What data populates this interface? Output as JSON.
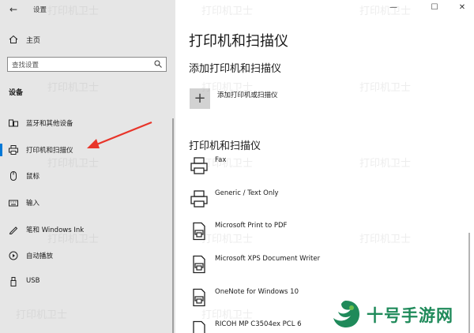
{
  "window": {
    "title": "设置",
    "minimize_icon": "minimize-icon",
    "maximize_icon": "maximize-icon",
    "close_icon": "close-icon"
  },
  "sidebar": {
    "back_icon": "back-arrow-icon",
    "home_label": "主页",
    "search_placeholder": "查找设置",
    "section_title": "设备",
    "items": [
      {
        "label": "蓝牙和其他设备",
        "icon": "bluetooth-device-icon"
      },
      {
        "label": "打印机和扫描仪",
        "icon": "printer-icon",
        "selected": true
      },
      {
        "label": "鼠标",
        "icon": "mouse-icon"
      },
      {
        "label": "输入",
        "icon": "keyboard-icon"
      },
      {
        "label": "笔和 Windows Ink",
        "icon": "pen-icon"
      },
      {
        "label": "自动播放",
        "icon": "autoplay-icon"
      },
      {
        "label": "USB",
        "icon": "usb-icon"
      }
    ]
  },
  "main": {
    "page_title": "打印机和扫描仪",
    "add_section_title": "添加打印机和扫描仪",
    "add_button_label": "添加打印机或扫描仪",
    "list_section_title": "打印机和扫描仪",
    "devices": [
      {
        "name": "Fax",
        "icon": "fax-icon"
      },
      {
        "name": "Generic / Text Only",
        "icon": "printer-icon"
      },
      {
        "name": "Microsoft Print to PDF",
        "icon": "document-printer-icon"
      },
      {
        "name": "Microsoft XPS Document Writer",
        "icon": "document-printer-icon"
      },
      {
        "name": "OneNote for Windows 10",
        "icon": "document-printer-icon"
      },
      {
        "name": "RICOH MP C3504ex PCL 6",
        "icon": "document-printer-icon"
      }
    ]
  },
  "watermark": {
    "text": "打印机卫士",
    "brand": "十号手游网"
  },
  "colors": {
    "sidebar_bg": "#e6e6e6",
    "accent": "#0078d7",
    "annotation_arrow": "#e8352a",
    "brand_green": "#1f8a5a"
  }
}
